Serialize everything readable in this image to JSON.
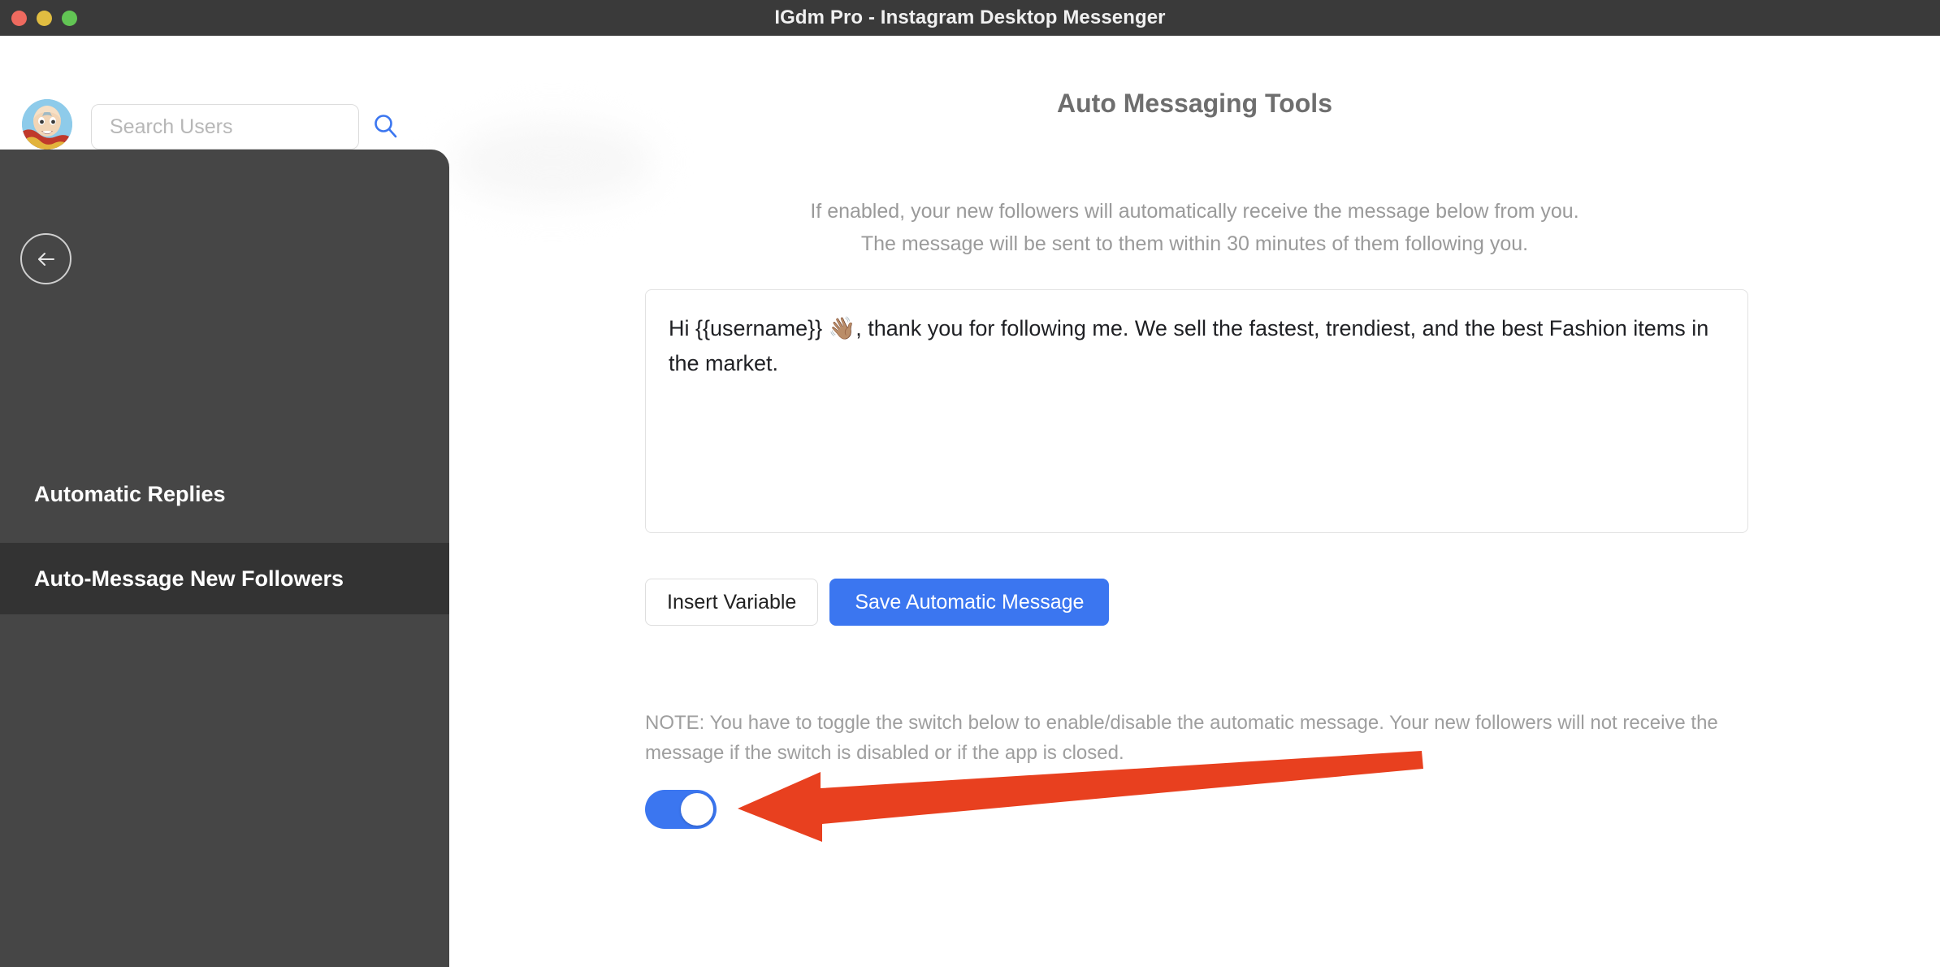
{
  "window": {
    "title": "IGdm Pro - Instagram Desktop Messenger",
    "traffic_lights": {
      "close_color": "#ee6a5f",
      "minimize_color": "#e0bd41",
      "maximize_color": "#62c554"
    },
    "titlebar_color": "#3a3a3a"
  },
  "topbar": {
    "avatar_alt": "user-avatar",
    "search": {
      "placeholder": "Search Users",
      "value": "",
      "icon": "search-icon",
      "icon_color": "#3b76f0"
    }
  },
  "sidebar": {
    "background_color": "#464646",
    "active_background_color": "#333333",
    "back_button_icon": "arrow-left-icon",
    "items": [
      {
        "label": "Automatic Replies",
        "active": false
      },
      {
        "label": "Auto-Message New Followers",
        "active": true
      }
    ]
  },
  "main": {
    "page_title": "Auto Messaging Tools",
    "description_line_1": "If enabled, your new followers will automatically receive the message below from you.",
    "description_line_2": "The message will be sent to them within 30 minutes of them following you.",
    "message": {
      "value": "Hi {{username}} 👋🏽, thank you for following me. We sell the fastest, trendiest, and the best Fashion items in the market.",
      "placeholder": ""
    },
    "buttons": {
      "insert_variable": "Insert Variable",
      "save_message": "Save Automatic Message",
      "primary_color": "#3b76f0"
    },
    "note": "NOTE: You have to toggle the switch below to enable/disable the automatic message. Your new followers will not receive the message if the switch is disabled or if the app is closed.",
    "toggle": {
      "state": "on",
      "on_color": "#3b76f0",
      "knob_color": "#ffffff"
    },
    "annotation": {
      "type": "arrow",
      "color": "#e8401f",
      "points_to": "enable-toggle"
    }
  }
}
